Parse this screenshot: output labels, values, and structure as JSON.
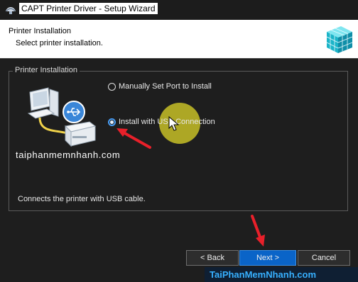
{
  "window": {
    "title": "CAPT Printer Driver - Setup Wizard"
  },
  "header": {
    "title": "Printer Installation",
    "subtitle": "Select printer installation."
  },
  "group": {
    "label": "Printer Installation",
    "options": [
      {
        "label": "Manually Set Port to Install",
        "selected": false
      },
      {
        "label": "Install with USB Connection",
        "selected": true
      }
    ],
    "description": "Connects the printer with USB cable."
  },
  "watermark": "taiphanmemnhanh.com",
  "buttons": {
    "back": "< Back",
    "next": "Next >",
    "cancel": "Cancel"
  },
  "brand": "TaiPhanMemNhanh.com",
  "colors": {
    "accent": "#0a64c8",
    "annotation_arrow": "#e8202a",
    "cursor_halo": "#d6ce28"
  }
}
